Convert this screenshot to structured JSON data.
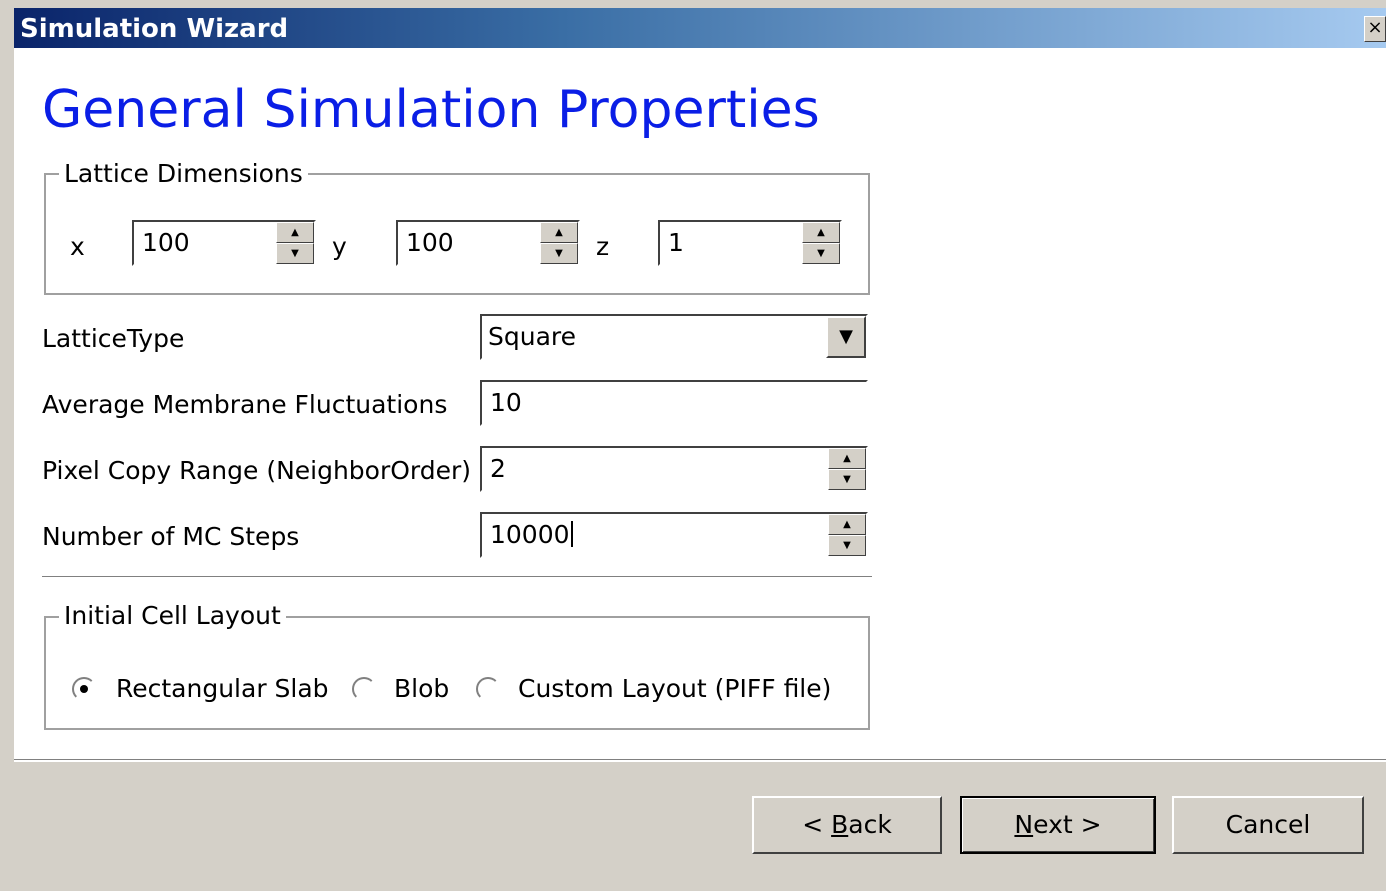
{
  "window": {
    "title": "Simulation Wizard",
    "close_glyph": "×"
  },
  "page": {
    "title": "General Simulation Properties"
  },
  "lattice_dimensions": {
    "legend": "Lattice Dimensions",
    "x_label": "x",
    "x_value": "100",
    "y_label": "y",
    "y_value": "100",
    "z_label": "z",
    "z_value": "1"
  },
  "form": {
    "lattice_type_label": "LatticeType",
    "lattice_type_value": "Square",
    "avg_membrane_label": "Average Membrane Fluctuations",
    "avg_membrane_value": "10",
    "pixel_copy_label": "Pixel Copy Range (NeighborOrder)",
    "pixel_copy_value": "2",
    "mc_steps_label": "Number of MC Steps",
    "mc_steps_value": "10000"
  },
  "initial_cell_layout": {
    "legend": "Initial Cell Layout",
    "options": [
      {
        "label": "Rectangular Slab",
        "selected": true
      },
      {
        "label": "Blob",
        "selected": false
      },
      {
        "label": "Custom Layout (PIFF file)",
        "selected": false
      }
    ]
  },
  "buttons": {
    "back_prefix": "< ",
    "back_mnemonic": "B",
    "back_rest": "ack",
    "next_mnemonic": "N",
    "next_rest": "ext >",
    "cancel": "Cancel"
  },
  "icons": {
    "spin_up": "▲",
    "spin_down": "▼",
    "dropdown": "▼"
  },
  "colors": {
    "title_gradient_start": "#0a246a",
    "title_gradient_end": "#a6caf0",
    "heading_blue": "#0a1ee6",
    "face": "#d4d0c8"
  }
}
